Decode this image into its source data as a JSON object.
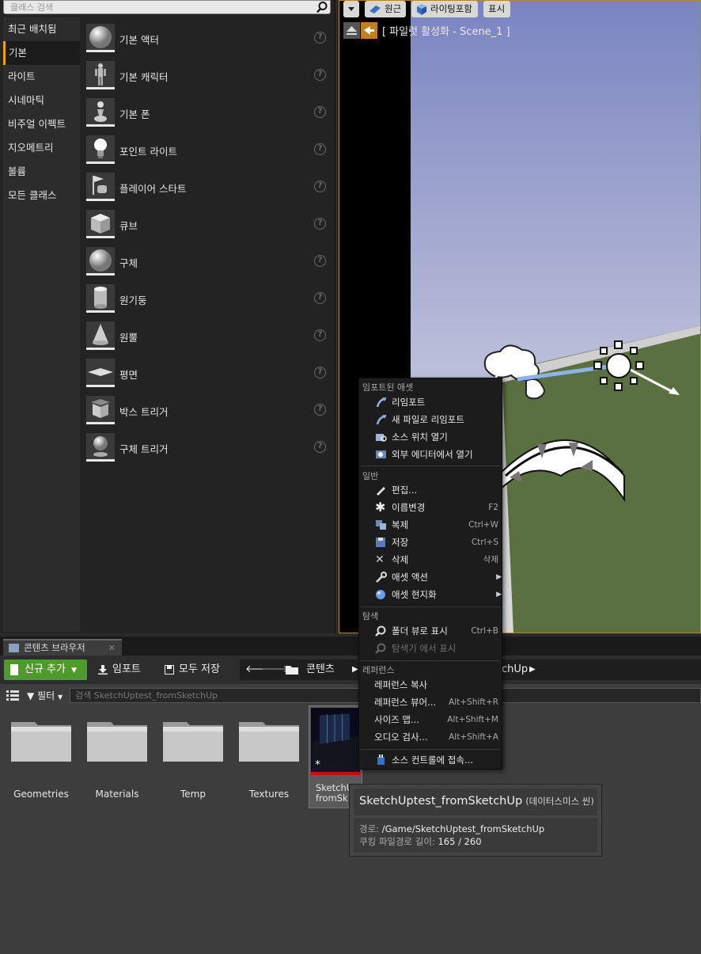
{
  "place_panel": {
    "search_placeholder": "클래스 검색",
    "categories": [
      "최근 배치됨",
      "기본",
      "라이트",
      "시네마틱",
      "비주얼 이펙트",
      "지오메트리",
      "볼륨",
      "모든 클래스"
    ],
    "active_category": "기본",
    "actors": [
      {
        "name": "기본 액터",
        "icon": "sphere-actor-icon"
      },
      {
        "name": "기본 캐릭터",
        "icon": "character-icon"
      },
      {
        "name": "기본 폰",
        "icon": "pawn-icon"
      },
      {
        "name": "포인트 라이트",
        "icon": "point-light-icon"
      },
      {
        "name": "플레이어 스타트",
        "icon": "player-start-icon"
      },
      {
        "name": "큐브",
        "icon": "cube-icon"
      },
      {
        "name": "구체",
        "icon": "sphere-icon"
      },
      {
        "name": "원기둥",
        "icon": "cylinder-icon"
      },
      {
        "name": "원뿔",
        "icon": "cone-icon"
      },
      {
        "name": "평면",
        "icon": "plane-icon"
      },
      {
        "name": "박스 트리거",
        "icon": "box-trigger-icon"
      },
      {
        "name": "구체 트리거",
        "icon": "sphere-trigger-icon"
      }
    ]
  },
  "viewport": {
    "perspective_label": "원근",
    "lighting_label": "라이팅포함",
    "show_label": "표시",
    "title": "[ 파일럿 활성화 - Scene_1 ]"
  },
  "content_browser": {
    "tab_label": "콘텐츠 브라우저",
    "add_new_label": "신규 추가",
    "import_label": "임포트",
    "save_all_label": "모두 저장",
    "path_root": "콘텐츠",
    "path_current_tail": "chUp",
    "filter_label": "필터",
    "search_placeholder": "검색 SketchUptest_fromSketchUp",
    "folders": [
      "Geometries",
      "Materials",
      "Temp",
      "Textures"
    ],
    "asset_label_line1": "SketchUp",
    "asset_label_line2": "fromSk"
  },
  "context_menu": {
    "sections": {
      "imported": "임포트된 애셋",
      "general": "일반",
      "explore": "탐색",
      "references": "레퍼런스"
    },
    "items": {
      "reimport": {
        "label": "리임포트"
      },
      "reimport_new": {
        "label": "새 파일로 리임포트"
      },
      "open_source": {
        "label": "소스 위치 열기"
      },
      "open_external": {
        "label": "외부 에디터에서 열기"
      },
      "edit": {
        "label": "편집..."
      },
      "rename": {
        "label": "이름변경",
        "shortcut": "F2"
      },
      "duplicate": {
        "label": "복제",
        "shortcut": "Ctrl+W"
      },
      "save": {
        "label": "저장",
        "shortcut": "Ctrl+S"
      },
      "delete": {
        "label": "삭제",
        "shortcut": "삭제"
      },
      "asset_actions": {
        "label": "애셋 액션"
      },
      "localize": {
        "label": "애셋 현지화"
      },
      "show_folder": {
        "label": "폴더 뷰로 표시",
        "shortcut": "Ctrl+B"
      },
      "show_explorer": {
        "label": "탐색기 에서 표시"
      },
      "copy_ref": {
        "label": "레퍼런스 복사"
      },
      "ref_viewer": {
        "label": "레퍼런스 뷰어...",
        "shortcut": "Alt+Shift+R"
      },
      "size_map": {
        "label": "사이즈 맵...",
        "shortcut": "Alt+Shift+M"
      },
      "audit": {
        "label": "오디오 검사...",
        "shortcut": "Alt+Shift+A"
      },
      "source_control": {
        "label": "소스 컨트롤에 접속..."
      }
    }
  },
  "tooltip": {
    "name": "SketchUptest_fromSketchUp",
    "type": "(데이터스미스 씬)",
    "path_key": "경로:",
    "path_value": "/Game/SketchUptest_fromSketchUp",
    "cook_key": "쿠킹 파일경로 길이:",
    "cook_value": "165 / 260"
  },
  "colors": {
    "accent_active": "#f0a000",
    "add_new_green": "#4e9a2a",
    "asset_underline": "#c01010",
    "viewport_border": "#b08a20"
  }
}
